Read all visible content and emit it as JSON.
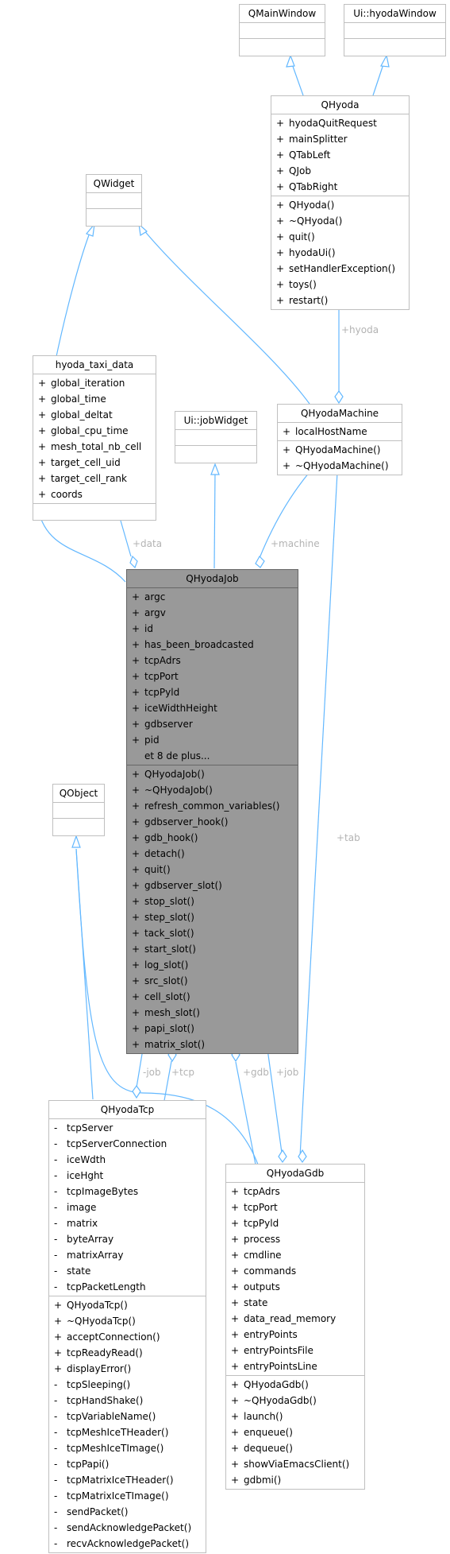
{
  "classes": {
    "qmainwindow": {
      "name": "QMainWindow"
    },
    "uihyodawindow": {
      "name": "Ui::hyodaWindow"
    },
    "qhyoda": {
      "name": "QHyoda",
      "attributes": [
        {
          "vis": "+",
          "name": "hyodaQuitRequest"
        },
        {
          "vis": "+",
          "name": "mainSplitter"
        },
        {
          "vis": "+",
          "name": "QTabLeft"
        },
        {
          "vis": "+",
          "name": "QJob"
        },
        {
          "vis": "+",
          "name": "QTabRight"
        }
      ],
      "methods": [
        {
          "vis": "+",
          "name": "QHyoda()"
        },
        {
          "vis": "+",
          "name": "~QHyoda()"
        },
        {
          "vis": "+",
          "name": "quit()"
        },
        {
          "vis": "+",
          "name": "hyodaUi()"
        },
        {
          "vis": "+",
          "name": "setHandlerException()"
        },
        {
          "vis": "+",
          "name": "toys()"
        },
        {
          "vis": "+",
          "name": "restart()"
        }
      ]
    },
    "qwidget": {
      "name": "QWidget"
    },
    "hyoda_taxi_data": {
      "name": "hyoda_taxi_data",
      "attributes": [
        {
          "vis": "+",
          "name": "global_iteration"
        },
        {
          "vis": "+",
          "name": "global_time"
        },
        {
          "vis": "+",
          "name": "global_deltat"
        },
        {
          "vis": "+",
          "name": "global_cpu_time"
        },
        {
          "vis": "+",
          "name": "mesh_total_nb_cell"
        },
        {
          "vis": "+",
          "name": "target_cell_uid"
        },
        {
          "vis": "+",
          "name": "target_cell_rank"
        },
        {
          "vis": "+",
          "name": "coords"
        }
      ]
    },
    "uijobwidget": {
      "name": "Ui::jobWidget"
    },
    "qhyodamachine": {
      "name": "QHyodaMachine",
      "attributes": [
        {
          "vis": "+",
          "name": "localHostName"
        }
      ],
      "methods": [
        {
          "vis": "+",
          "name": "QHyodaMachine()"
        },
        {
          "vis": "+",
          "name": "~QHyodaMachine()"
        }
      ]
    },
    "qhyodajob": {
      "name": "QHyodaJob",
      "attributes": [
        {
          "vis": "+",
          "name": "argc"
        },
        {
          "vis": "+",
          "name": "argv"
        },
        {
          "vis": "+",
          "name": "id"
        },
        {
          "vis": "+",
          "name": "has_been_broadcasted"
        },
        {
          "vis": "+",
          "name": "tcpAdrs"
        },
        {
          "vis": "+",
          "name": "tcpPort"
        },
        {
          "vis": "+",
          "name": "tcpPyld"
        },
        {
          "vis": "+",
          "name": "iceWidthHeight"
        },
        {
          "vis": "+",
          "name": "gdbserver"
        },
        {
          "vis": "+",
          "name": "pid"
        },
        {
          "vis": "",
          "name": "et 8 de plus..."
        }
      ],
      "methods": [
        {
          "vis": "+",
          "name": "QHyodaJob()"
        },
        {
          "vis": "+",
          "name": "~QHyodaJob()"
        },
        {
          "vis": "+",
          "name": "refresh_common_variables()"
        },
        {
          "vis": "+",
          "name": "gdbserver_hook()"
        },
        {
          "vis": "+",
          "name": "gdb_hook()"
        },
        {
          "vis": "+",
          "name": "detach()"
        },
        {
          "vis": "+",
          "name": "quit()"
        },
        {
          "vis": "+",
          "name": "gdbserver_slot()"
        },
        {
          "vis": "+",
          "name": "stop_slot()"
        },
        {
          "vis": "+",
          "name": "step_slot()"
        },
        {
          "vis": "+",
          "name": "tack_slot()"
        },
        {
          "vis": "+",
          "name": "start_slot()"
        },
        {
          "vis": "+",
          "name": "log_slot()"
        },
        {
          "vis": "+",
          "name": "src_slot()"
        },
        {
          "vis": "+",
          "name": "cell_slot()"
        },
        {
          "vis": "+",
          "name": "mesh_slot()"
        },
        {
          "vis": "+",
          "name": "papi_slot()"
        },
        {
          "vis": "+",
          "name": "matrix_slot()"
        }
      ]
    },
    "qobject": {
      "name": "QObject"
    },
    "qhyodatcp": {
      "name": "QHyodaTcp",
      "attributes": [
        {
          "vis": "-",
          "name": "tcpServer"
        },
        {
          "vis": "-",
          "name": "tcpServerConnection"
        },
        {
          "vis": "-",
          "name": "iceWdth"
        },
        {
          "vis": "-",
          "name": "iceHght"
        },
        {
          "vis": "-",
          "name": "tcpImageBytes"
        },
        {
          "vis": "-",
          "name": "image"
        },
        {
          "vis": "-",
          "name": "matrix"
        },
        {
          "vis": "-",
          "name": "byteArray"
        },
        {
          "vis": "-",
          "name": "matrixArray"
        },
        {
          "vis": "-",
          "name": "state"
        },
        {
          "vis": "-",
          "name": "tcpPacketLength"
        }
      ],
      "methods": [
        {
          "vis": "+",
          "name": "QHyodaTcp()"
        },
        {
          "vis": "+",
          "name": "~QHyodaTcp()"
        },
        {
          "vis": "+",
          "name": "acceptConnection()"
        },
        {
          "vis": "+",
          "name": "tcpReadyRead()"
        },
        {
          "vis": "+",
          "name": "displayError()"
        },
        {
          "vis": "-",
          "name": "tcpSleeping()"
        },
        {
          "vis": "-",
          "name": "tcpHandShake()"
        },
        {
          "vis": "-",
          "name": "tcpVariableName()"
        },
        {
          "vis": "-",
          "name": "tcpMeshIceTHeader()"
        },
        {
          "vis": "-",
          "name": "tcpMeshIceTImage()"
        },
        {
          "vis": "-",
          "name": "tcpPapi()"
        },
        {
          "vis": "-",
          "name": "tcpMatrixIceTHeader()"
        },
        {
          "vis": "-",
          "name": "tcpMatrixIceTImage()"
        },
        {
          "vis": "-",
          "name": "sendPacket()"
        },
        {
          "vis": "-",
          "name": "sendAcknowledgePacket()"
        },
        {
          "vis": "-",
          "name": "recvAcknowledgePacket()"
        }
      ]
    },
    "qhyodagdb": {
      "name": "QHyodaGdb",
      "attributes": [
        {
          "vis": "+",
          "name": "tcpAdrs"
        },
        {
          "vis": "+",
          "name": "tcpPort"
        },
        {
          "vis": "+",
          "name": "tcpPyld"
        },
        {
          "vis": "+",
          "name": "process"
        },
        {
          "vis": "+",
          "name": "cmdline"
        },
        {
          "vis": "+",
          "name": "commands"
        },
        {
          "vis": "+",
          "name": "outputs"
        },
        {
          "vis": "+",
          "name": "state"
        },
        {
          "vis": "+",
          "name": "data_read_memory"
        },
        {
          "vis": "+",
          "name": "entryPoints"
        },
        {
          "vis": "+",
          "name": "entryPointsFile"
        },
        {
          "vis": "+",
          "name": "entryPointsLine"
        }
      ],
      "methods": [
        {
          "vis": "+",
          "name": "QHyodaGdb()"
        },
        {
          "vis": "+",
          "name": "~QHyodaGdb()"
        },
        {
          "vis": "+",
          "name": "launch()"
        },
        {
          "vis": "+",
          "name": "enqueue()"
        },
        {
          "vis": "+",
          "name": "dequeue()"
        },
        {
          "vis": "+",
          "name": "showViaEmacsClient()"
        },
        {
          "vis": "+",
          "name": "gdbmi()"
        }
      ]
    }
  },
  "edge_labels": {
    "hyoda": "+hyoda",
    "data": "+data",
    "machine": "+machine",
    "tab": "+tab",
    "tcp_job": "-job",
    "tcp": "+tcp",
    "gdb": "+gdb",
    "gdb_job": "+job"
  },
  "colors": {
    "edge": "#63b8ff",
    "highlight_fill": "#999999",
    "border": "#bfbfbf",
    "label": "#b3b3b3"
  }
}
